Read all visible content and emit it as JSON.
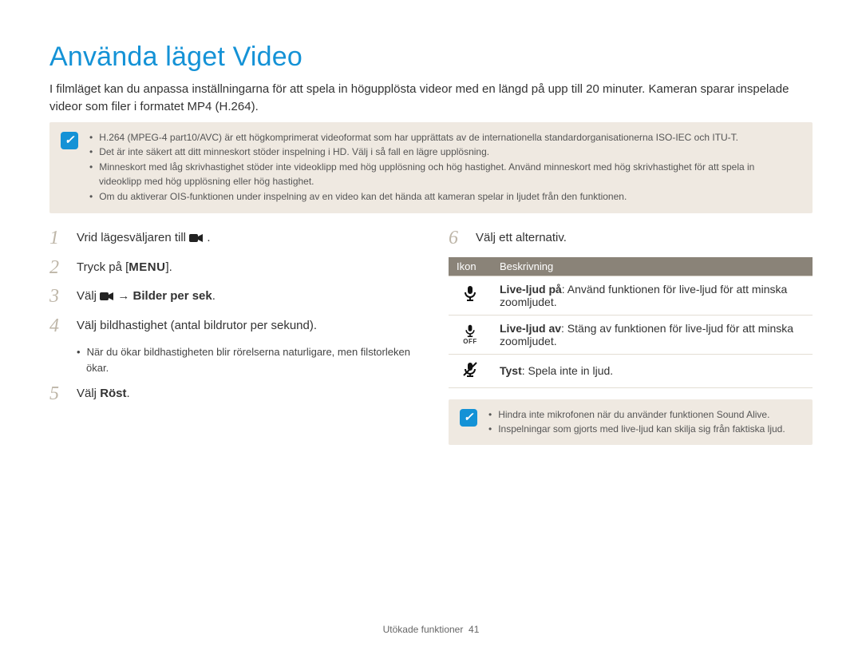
{
  "title": "Använda läget Video",
  "intro": "I filmläget kan du anpassa inställningarna för att spela in högupplösta videor med en längd på upp till 20 minuter. Kameran sparar inspelade videor som filer i formatet MP4 (H.264).",
  "note1": {
    "items": [
      "H.264 (MPEG-4 part10/AVC) är ett högkomprimerat videoformat som har upprättats av de internationella standardorganisationerna ISO-IEC och ITU-T.",
      "Det är inte säkert att ditt minneskort stöder inspelning i HD. Välj i så fall en lägre upplösning.",
      "Minneskort med låg skrivhastighet stöder inte videoklipp med hög upplösning och hög hastighet. Använd minneskort med hög skrivhastighet för att spela in videoklipp med hög upplösning eller hög hastighet.",
      "Om du aktiverar OIS-funktionen under inspelning av en video kan det hända att kameran spelar in ljudet från den funktionen."
    ]
  },
  "left_steps": {
    "s1_pre": "Vrid lägesväljaren till ",
    "s1_suf": ".",
    "s2_pre": "Tryck på [",
    "s2_mid": "MENU",
    "s2_suf": "].",
    "s3_pre": "Välj ",
    "s3_arrow": " → ",
    "s3_bold": "Bilder per sek",
    "s3_suf": ".",
    "s4": "Välj bildhastighet (antal bildrutor per sekund).",
    "s4_sub": "När du ökar bildhastigheten blir rörelserna naturligare, men filstorleken ökar.",
    "s5_pre": "Välj ",
    "s5_bold": "Röst",
    "s5_suf": "."
  },
  "right_steps": {
    "s6": "Välj ett alternativ."
  },
  "table": {
    "headers": {
      "icon": "Ikon",
      "desc": "Beskrivning"
    },
    "rows": [
      {
        "icon": "mic-on",
        "bold": "Live-ljud på",
        "text": ": Använd funktionen för live-ljud för att minska zoomljudet."
      },
      {
        "icon": "mic-off",
        "bold": "Live-ljud av",
        "text": ": Stäng av funktionen för live-ljud för att minska zoomljudet."
      },
      {
        "icon": "mic-mute",
        "bold": "Tyst",
        "text": ": Spela inte in ljud."
      }
    ]
  },
  "note2": {
    "items": [
      "Hindra inte mikrofonen när du använder funktionen Sound Alive.",
      "Inspelningar som gjorts med live-ljud kan skilja sig från faktiska ljud."
    ]
  },
  "footer": {
    "section": "Utökade funktioner",
    "page": "41"
  }
}
